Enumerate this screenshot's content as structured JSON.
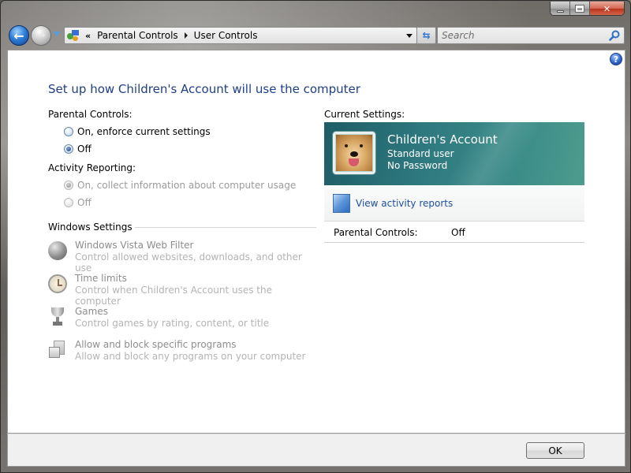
{
  "window": {
    "caption_buttons": [
      "minimize",
      "maximize",
      "close"
    ]
  },
  "nav": {
    "back_icon": "back-arrow-icon",
    "forward_icon": "forward-arrow-icon",
    "overflow_chevron": "«",
    "breadcrumbs": [
      "Parental Controls",
      "User Controls"
    ],
    "search_placeholder": "Search"
  },
  "main": {
    "title": "Set up how Children's Account will use the computer",
    "parental_controls": {
      "label": "Parental Controls:",
      "options": [
        {
          "label": "On, enforce current settings",
          "checked": false,
          "enabled": true
        },
        {
          "label": "Off",
          "checked": true,
          "enabled": true
        }
      ]
    },
    "activity_reporting": {
      "label": "Activity Reporting:",
      "options": [
        {
          "label": "On, collect information about computer usage",
          "checked": true,
          "enabled": false
        },
        {
          "label": "Off",
          "checked": false,
          "enabled": false
        }
      ]
    },
    "windows_settings": {
      "header": "Windows Settings",
      "items": [
        {
          "icon": "globe-icon",
          "title": "Windows Vista Web Filter",
          "description": "Control allowed websites, downloads, and other use"
        },
        {
          "icon": "stopwatch-icon",
          "title": "Time limits",
          "description": "Control when Children's Account uses the computer"
        },
        {
          "icon": "trophy-icon",
          "title": "Games",
          "description": "Control games by rating, content, or title"
        },
        {
          "icon": "programs-icon",
          "title": "Allow and block specific programs",
          "description": "Allow and block any programs on your computer"
        }
      ]
    }
  },
  "current_settings": {
    "label": "Current Settings:",
    "account_name": "Children's Account",
    "account_type": "Standard user",
    "password_status": "No Password",
    "reports_link": "View activity reports",
    "status_label": "Parental Controls:",
    "status_value": "Off"
  },
  "footer": {
    "ok_label": "OK"
  },
  "colors": {
    "title": "#1e3f87",
    "link": "#1f4e9e",
    "card": "#2f7a80"
  }
}
